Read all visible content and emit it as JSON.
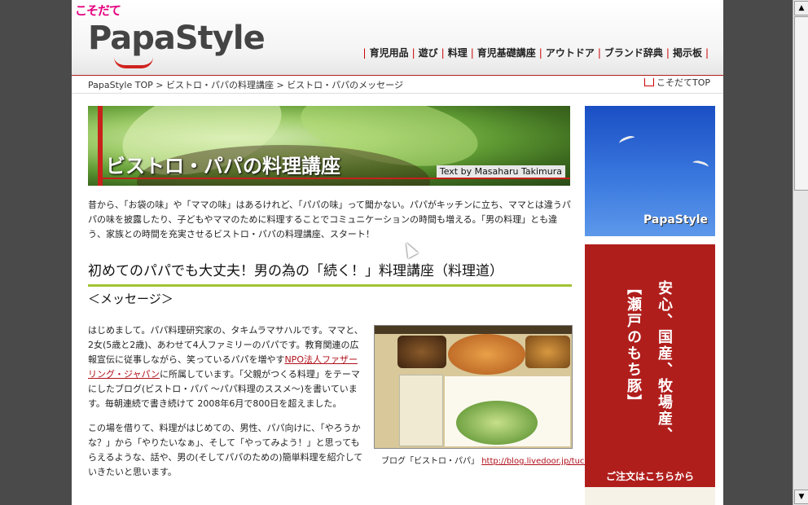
{
  "logo": {
    "kosodate": "こそだて",
    "main": "PapaStyle"
  },
  "nav": {
    "items": [
      {
        "label": "育児用品"
      },
      {
        "label": "遊び"
      },
      {
        "label": "料理"
      },
      {
        "label": "育児基礎講座"
      },
      {
        "label": "アウトドア"
      },
      {
        "label": "ブランド辞典"
      },
      {
        "label": "掲示板"
      }
    ]
  },
  "breadcrumb": {
    "items": [
      {
        "label": "PapaStyle TOP"
      },
      {
        "label": "ビストロ・パパの料理講座"
      },
      {
        "label": "ビストロ・パパのメッセージ"
      }
    ],
    "separator": ">"
  },
  "home_link": {
    "label": "こそだてTOP"
  },
  "banner": {
    "title": "ビストロ・パパの料理講座",
    "credit": "Text by Masaharu Takimura"
  },
  "intro": "昔から、「お袋の味」や「ママの味」はあるけれど、「パパの味」って聞かない。パパがキッチンに立ち、ママとは違うパパの味を披露したり、子どもやママのために料理することでコミュニケーションの時間も増える。「男の料理」とも違う、家族との時間を充実させるビストロ・パパの料理講座、スタート！",
  "heading": "初めてのパパでも大丈夫！男の為の「続く！」料理講座（料理道）",
  "subheading": "＜メッセージ＞",
  "body": {
    "p1_a": "はじめまして。パパ料理研究家の、タキムラマサハルです。ママと、2女(5歳と2歳)、あわせて4人ファミリーのパパです。教育関連の広報宣伝に従事しながら、笑っているパパを増やす",
    "p1_link": "NPO法人ファザーリング・ジャパン",
    "p1_b": "に所属しています。「父親がつくる料理」をテーマにしたブログ(ビストロ・パパ 〜パパ料理のススメ〜)を書いています。毎朝連続で書き続けて 2008年6月で800日を超えました。",
    "p2": "この場を借りて、料理がはじめての、男性、パパ向けに、「やろうかな？」から「やりたいなぁ」、そして「やってみよう！」と思ってもらえるような、話や、男の(そしてパパのための)簡単料理を紹介していきたいと思います。"
  },
  "blog_caption": {
    "label": "ブログ「ビストロ・パパ」",
    "url": "http://blog.livedoor.jp/tuckeym/"
  },
  "ad_sky": {
    "logo": "PapaStyle"
  },
  "ad_red": {
    "line1": "安心、国産、牧場産、",
    "line2": "【瀬戸のもち豚】",
    "order": "ご注文はこちらから"
  },
  "scrollbar": {
    "up": "▲",
    "down": "▼"
  }
}
